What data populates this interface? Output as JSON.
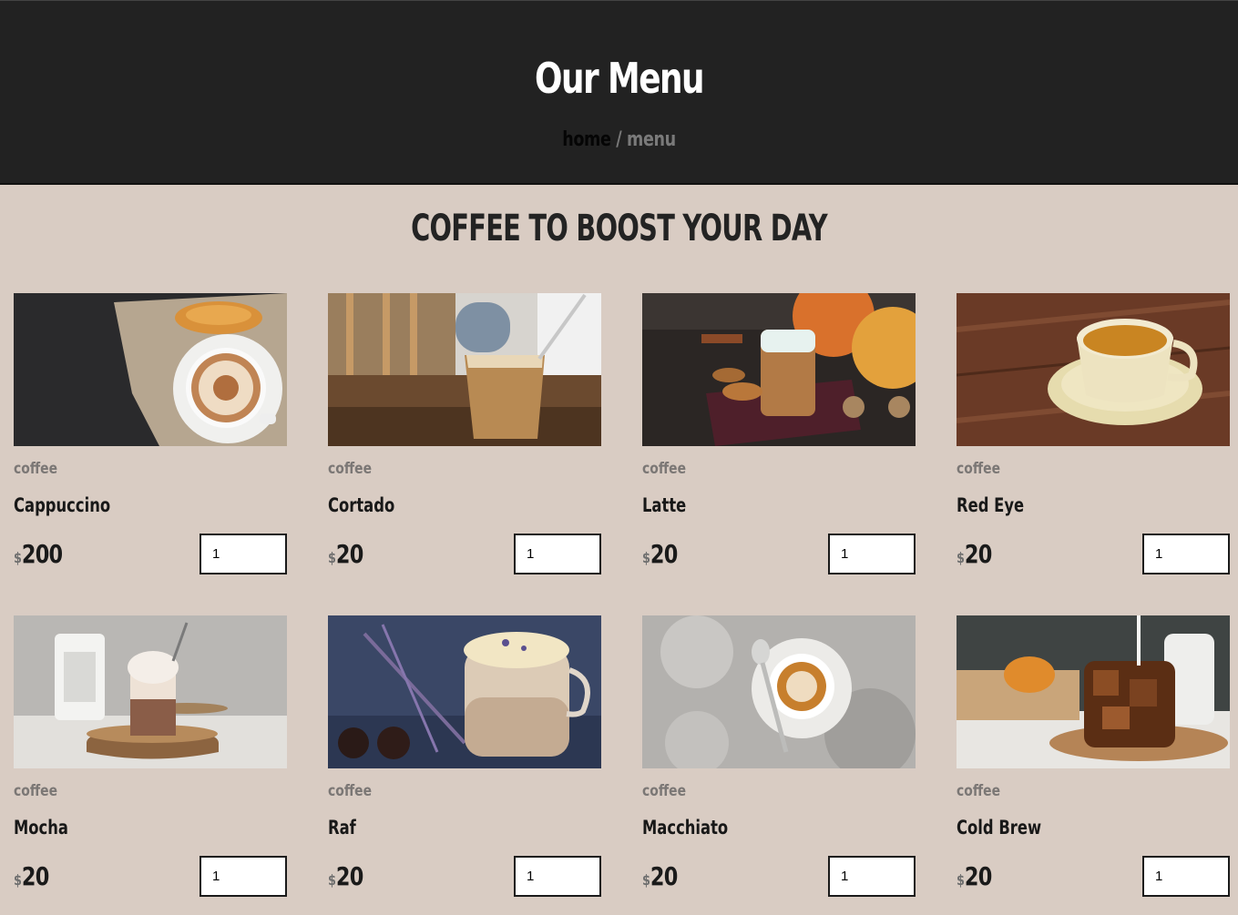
{
  "header": {
    "title": "Our Menu",
    "breadcrumb_home": "home",
    "breadcrumb_separator": " / ",
    "breadcrumb_current": "menu"
  },
  "section": {
    "title": "COFFEE TO BOOST YOUR DAY"
  },
  "products": [
    {
      "category": "coffee",
      "name": "Cappuccino",
      "currency": "$",
      "price": "200",
      "quantity": "1"
    },
    {
      "category": "coffee",
      "name": "Cortado",
      "currency": "$",
      "price": "20",
      "quantity": "1"
    },
    {
      "category": "coffee",
      "name": "Latte",
      "currency": "$",
      "price": "20",
      "quantity": "1"
    },
    {
      "category": "coffee",
      "name": "Red Eye",
      "currency": "$",
      "price": "20",
      "quantity": "1"
    },
    {
      "category": "coffee",
      "name": "Mocha",
      "currency": "$",
      "price": "20",
      "quantity": "1"
    },
    {
      "category": "coffee",
      "name": "Raf",
      "currency": "$",
      "price": "20",
      "quantity": "1"
    },
    {
      "category": "coffee",
      "name": "Macchiato",
      "currency": "$",
      "price": "20",
      "quantity": "1"
    },
    {
      "category": "coffee",
      "name": "Cold Brew",
      "currency": "$",
      "price": "20",
      "quantity": "1"
    }
  ],
  "colors": {
    "header_bg": "#222222",
    "page_bg": "#d9ccc3",
    "text_dark": "#1e1e1e",
    "muted": "#7b7775"
  }
}
